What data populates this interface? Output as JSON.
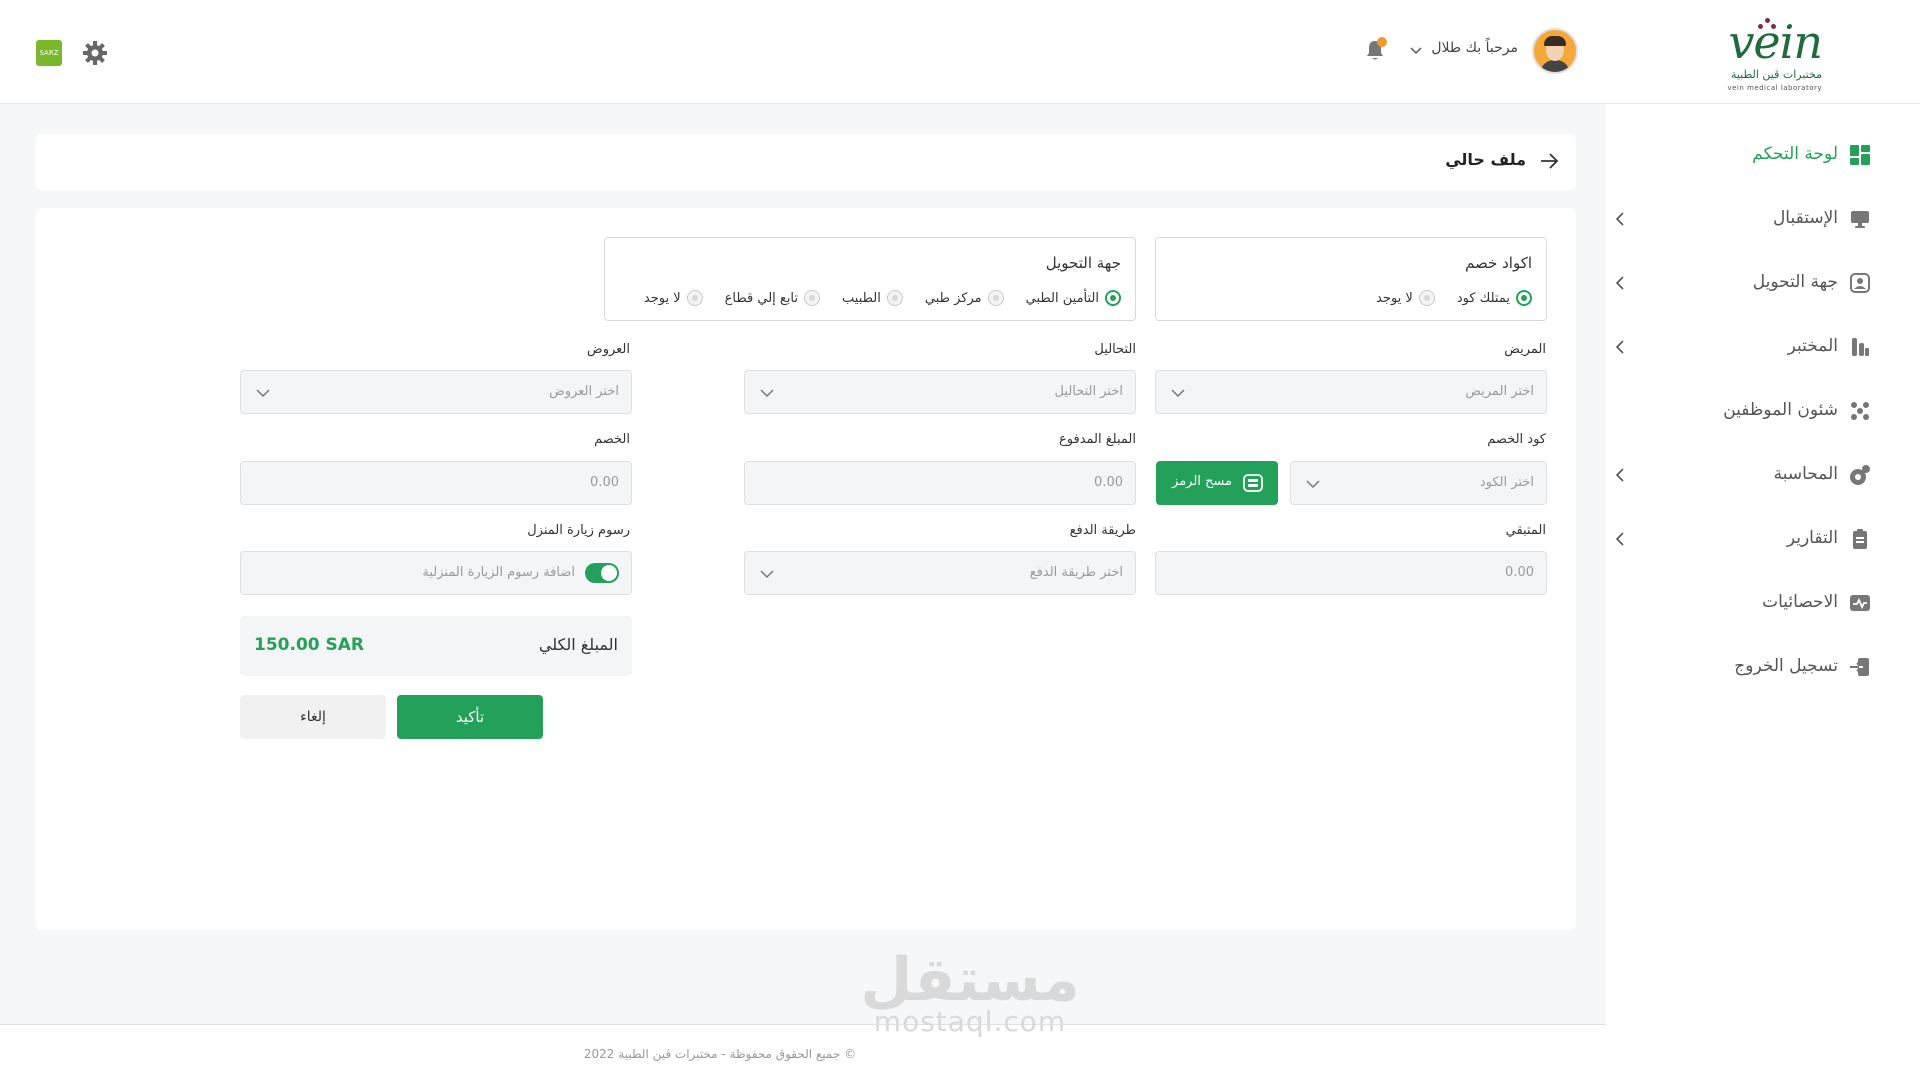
{
  "header": {
    "logo_word": "vein",
    "logo_ar": "مختبرات ڤين الطبية",
    "logo_en": "vein medical laboratory",
    "welcome": "مرحباً بك طلال",
    "flag_text": "SARZ"
  },
  "sidebar": {
    "items": [
      {
        "label": "لوحة التحكم",
        "icon": "dashboard-icon",
        "active": true
      },
      {
        "label": "الإستقبال",
        "icon": "monitor-icon"
      },
      {
        "label": "جهة التحويل",
        "icon": "referral-icon"
      },
      {
        "label": "المختبر",
        "icon": "lab-icon"
      },
      {
        "label": "شئون الموظفين",
        "icon": "staff-icon"
      },
      {
        "label": "المحاسبة",
        "icon": "accounting-icon"
      },
      {
        "label": "التقارير",
        "icon": "reports-icon"
      },
      {
        "label": "الاحصائيات",
        "icon": "stats-icon"
      },
      {
        "label": "تسجيل الخروج",
        "icon": "logout-icon"
      }
    ]
  },
  "breadcrumb": {
    "title": "ملف حالي"
  },
  "form": {
    "discount_codes": {
      "title": "اكواد خصم",
      "options": [
        "يمتلك كود",
        "لا يوجد"
      ]
    },
    "referral": {
      "title": "جهة التحويل",
      "options": [
        "التأمين الطبي",
        "مركز طبي",
        "الطبيب",
        "تابع إلي قطاع",
        "لا يوجد"
      ]
    },
    "patient": {
      "label": "المريض",
      "placeholder": "اختر المريض"
    },
    "tests": {
      "label": "التحاليل",
      "placeholder": "اختر التحاليل"
    },
    "offers": {
      "label": "العروض",
      "placeholder": "اختر العروض"
    },
    "discount_code": {
      "label": "كود الخصم",
      "placeholder": "اختر الكود",
      "scan_label": "مسح الرمز"
    },
    "paid_amount": {
      "label": "المبلغ المدفوع",
      "value": "0.00"
    },
    "discount": {
      "label": "الخصم",
      "value": "0.00"
    },
    "remaining": {
      "label": "المتبقي",
      "value": "0.00"
    },
    "payment_method": {
      "label": "طريقة الدفع",
      "placeholder": "اختر طريقة الدفع"
    },
    "home_visit": {
      "label": "رسوم زيارة المنزل",
      "placeholder": "اضافة رسوم الزيارة المنزلية"
    },
    "total": {
      "label": "المبلغ الكلي",
      "amount": "150.00 SAR"
    },
    "confirm_label": "تأكيد",
    "cancel_label": "إلغاء"
  },
  "footer": {
    "text": "© جميع الحقوق محفوظة - مختبرات ڤين الطبية 2022"
  },
  "watermark": {
    "ar": "مستقل",
    "en": "mostaql.com"
  },
  "colors": {
    "accent": "#23a15a",
    "badge": "#f29a2e"
  }
}
